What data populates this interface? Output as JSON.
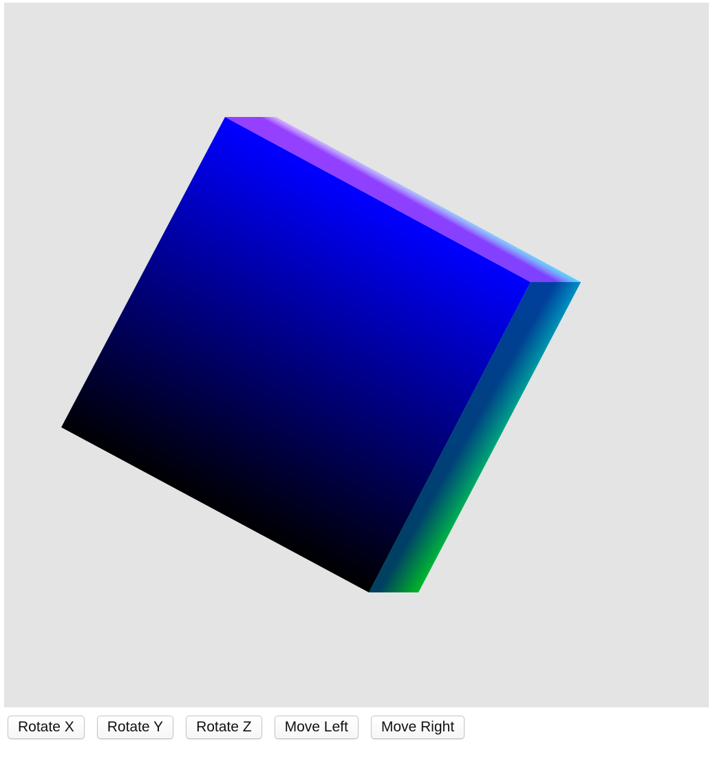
{
  "scene": {
    "background_color": "#e4e4e4",
    "object": "cube",
    "corner_colors": {
      "top": "#ff22ff",
      "left": "#ff0000",
      "bottom": "#000000",
      "right": "#0000ff",
      "right_edge": "#00ffff",
      "bottom_right": "#00ff00",
      "top_ridge": "#ffffff"
    }
  },
  "controls": {
    "rotate_x": "Rotate X",
    "rotate_y": "Rotate Y",
    "rotate_z": "Rotate Z",
    "move_left": "Move Left",
    "move_right": "Move Right"
  }
}
